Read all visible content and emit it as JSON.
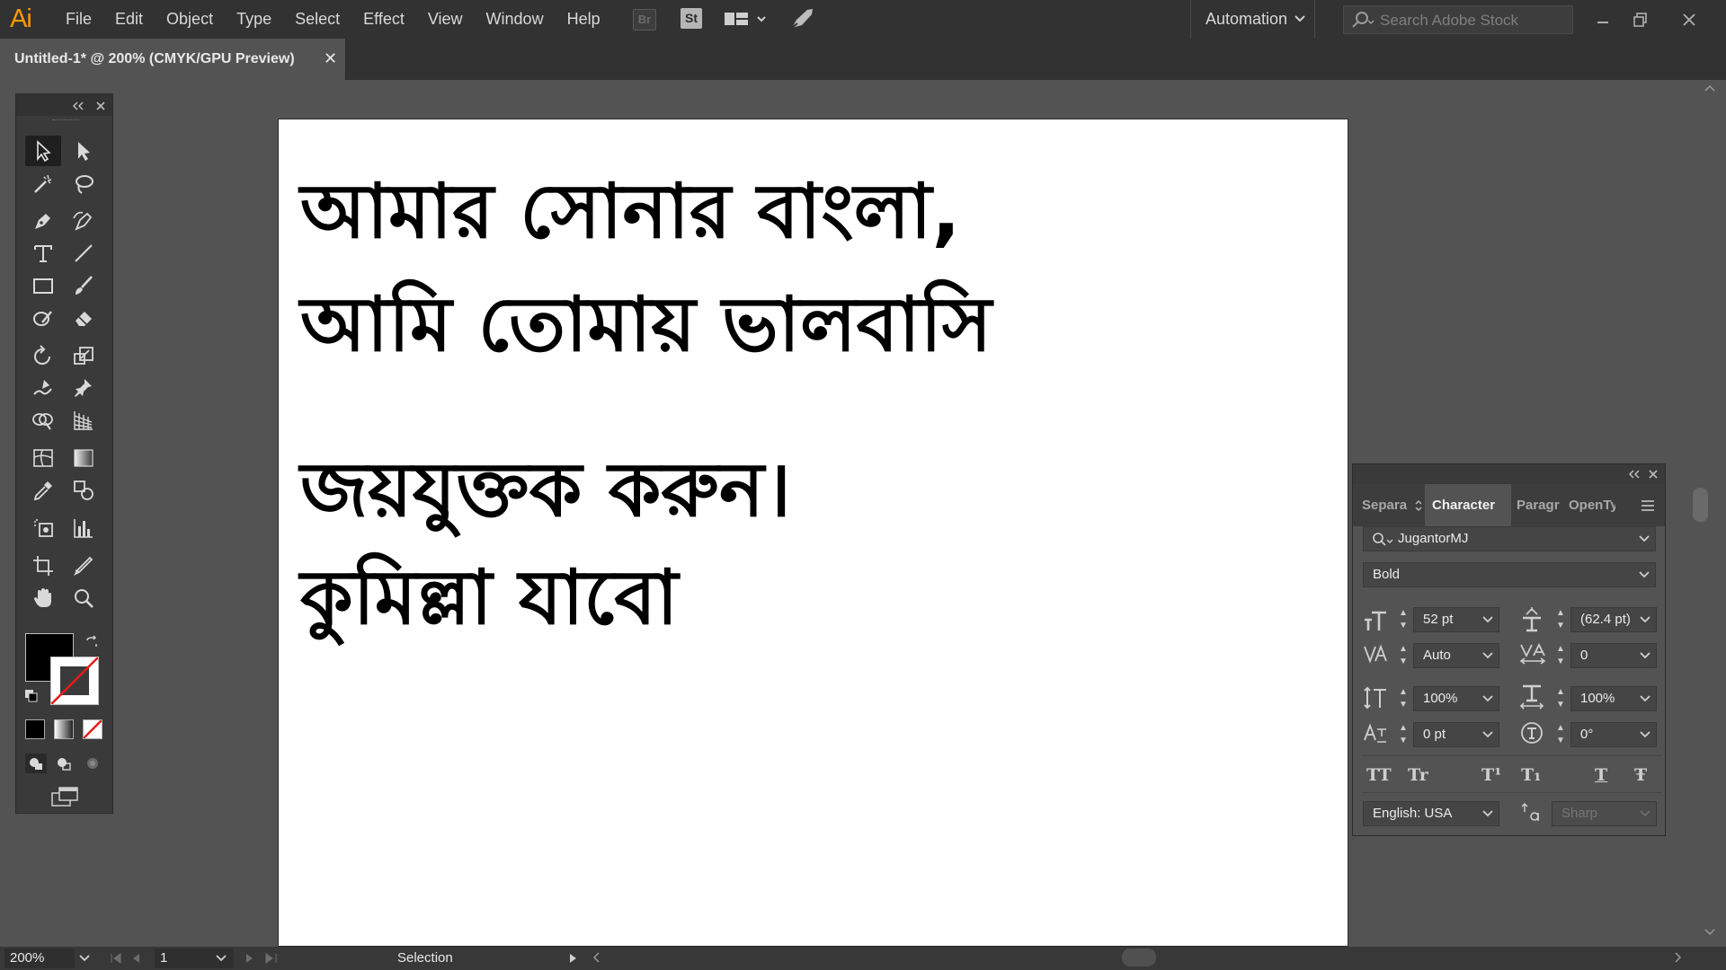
{
  "app": {
    "logo": "Ai",
    "menu": [
      "File",
      "Edit",
      "Object",
      "Type",
      "Select",
      "Effect",
      "View",
      "Window",
      "Help"
    ],
    "bridge_label": "Br",
    "stock_label": "St",
    "workspace": "Automation",
    "search_placeholder": "Search Adobe Stock"
  },
  "document": {
    "tab_title": "Untitled-1* @ 200% (CMYK/GPU Preview)",
    "close_glyph": "✕"
  },
  "artboard": {
    "lines": [
      "আমার সোনার বাংলা,",
      "আমি তোমায় ভালবাসি",
      "জয়যুক্তক করুন।",
      "কুমিল্লা যাবো"
    ]
  },
  "character_panel": {
    "tabs": [
      "Separa",
      "Character",
      "Paragr",
      "OpenTy"
    ],
    "font_family": "JugantorMJ",
    "font_style": "Bold",
    "font_size": "52 pt",
    "leading": "(62.4 pt)",
    "kerning": "Auto",
    "tracking": "0",
    "vertical_scale": "100%",
    "horizontal_scale": "100%",
    "baseline_shift": "0 pt",
    "rotation": "0°",
    "language": "English: USA",
    "antialias": "Sharp",
    "case_buttons": [
      "TT",
      "Tr",
      "T¹",
      "T₁",
      "T",
      "Ŧ"
    ]
  },
  "status": {
    "zoom": "200%",
    "artboard_number": "1",
    "tool": "Selection"
  },
  "colors": {
    "accent": "#ff9a00",
    "chrome": "#323232",
    "panel": "#535353",
    "fill": "#000000"
  }
}
